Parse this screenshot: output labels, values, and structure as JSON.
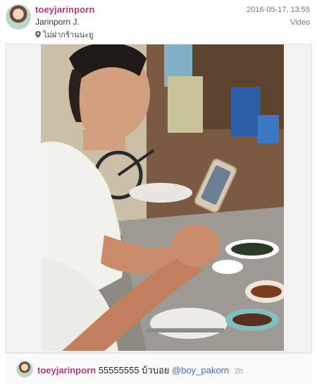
{
  "post": {
    "username": "toeyjarinporn",
    "full_name": "Jarinporn J.",
    "location": "ไม่ฝากร้านนะยู",
    "timestamp": "2016-05-17, 13:55",
    "media_type": "Video"
  },
  "caption": {
    "username": "toeyjarinporn",
    "text": "55555555 บ้วบอย",
    "mention": "@boy_pakorn",
    "time": "2h"
  },
  "icons": {
    "location": "location-pin-icon"
  },
  "colors": {
    "username": "#b33a73",
    "mention": "#3d6db5",
    "meta": "#777777"
  }
}
